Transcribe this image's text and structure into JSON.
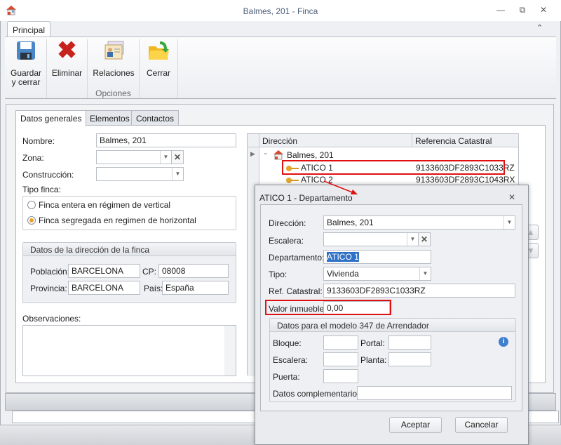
{
  "window": {
    "title": "Balmes, 201 - Finca",
    "minimize": "—",
    "restore": "⧉",
    "close": "✕"
  },
  "ribbon": {
    "tab": "Principal",
    "collapse": "⌃",
    "group_label": "Opciones",
    "buttons": [
      {
        "label1": "Guardar",
        "label2": "y cerrar"
      },
      {
        "label1": "Eliminar"
      },
      {
        "label1": "Relaciones"
      },
      {
        "label1": "Cerrar"
      }
    ]
  },
  "tabs": [
    "Datos generales",
    "Elementos",
    "Contactos"
  ],
  "form": {
    "nombre_label": "Nombre:",
    "nombre": "Balmes, 201",
    "zona_label": "Zona:",
    "zona": "",
    "construccion_label": "Construcción:",
    "construccion": "",
    "tipo_label": "Tipo finca:",
    "tipo_options": [
      "Finca entera en régimen de vertical",
      "Finca segregada en regimen de horizontal"
    ],
    "tipo_selected": 1,
    "direccion_group": "Datos de la dirección de la finca",
    "poblacion_label": "Población:",
    "poblacion": "BARCELONA",
    "cp_label": "CP:",
    "cp": "08008",
    "provincia_label": "Provincia:",
    "provincia": "BARCELONA",
    "pais_label": "País:",
    "pais": "España",
    "observaciones_label": "Observaciones:"
  },
  "grid": {
    "columns": [
      "Dirección",
      "Referencia Catastral"
    ],
    "root": "Balmes, 201",
    "rows": [
      {
        "name": "ATICO 1",
        "ref": "9133603DF2893C1033RZ"
      },
      {
        "name": "ATICO 2",
        "ref": "9133603DF2893C1043RX"
      }
    ]
  },
  "dialog": {
    "title": "ATICO 1 - Departamento",
    "close": "✕",
    "direccion_label": "Dirección:",
    "direccion": "Balmes, 201",
    "escalera_label": "Escalera:",
    "escalera": "",
    "departamento_label": "Departamento:",
    "departamento": "ATICO 1",
    "tipo_label": "Tipo:",
    "tipo": "Vivienda",
    "ref_label": "Ref. Catastral:",
    "ref": "9133603DF2893C1033RZ",
    "valor_label": "Valor inmueble:",
    "valor": "0,00",
    "group347": "Datos para el modelo 347 de Arrendador",
    "bloque_label": "Bloque:",
    "portal_label": "Portal:",
    "escalera2_label": "Escalera:",
    "planta_label": "Planta:",
    "puerta_label": "Puerta:",
    "datos_comp_label": "Datos complementarios:",
    "accept": "Aceptar",
    "cancel": "Cancelar"
  },
  "colors": {
    "highlight": "#e01010",
    "selection": "#3072c8"
  }
}
